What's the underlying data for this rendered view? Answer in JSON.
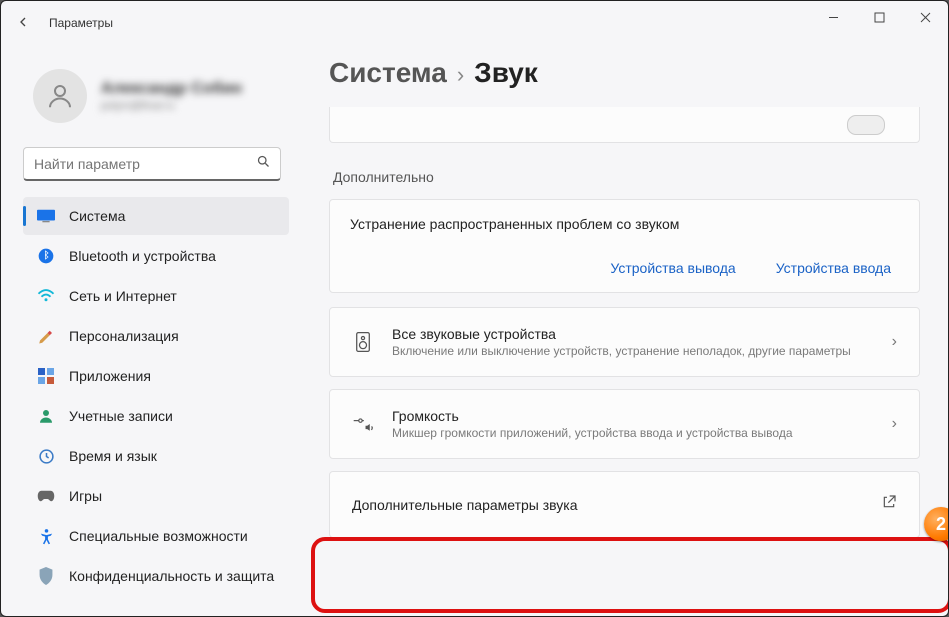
{
  "window": {
    "title": "Параметры"
  },
  "user": {
    "name": "Александр Собин",
    "email": "polym@final.ru"
  },
  "search": {
    "placeholder": "Найти параметр"
  },
  "sidebar": {
    "items": [
      {
        "label": "Система",
        "icon": "monitor",
        "active": true
      },
      {
        "label": "Bluetooth и устройства",
        "icon": "bluetooth"
      },
      {
        "label": "Сеть и Интернет",
        "icon": "wifi"
      },
      {
        "label": "Персонализация",
        "icon": "brush"
      },
      {
        "label": "Приложения",
        "icon": "apps"
      },
      {
        "label": "Учетные записи",
        "icon": "account"
      },
      {
        "label": "Время и язык",
        "icon": "time"
      },
      {
        "label": "Игры",
        "icon": "games"
      },
      {
        "label": "Специальные возможности",
        "icon": "accessibility"
      },
      {
        "label": "Конфиденциальность и защита",
        "icon": "privacy"
      }
    ]
  },
  "breadcrumb": {
    "parent": "Система",
    "current": "Звук"
  },
  "additional": {
    "heading": "Дополнительно",
    "troubleshoot": {
      "title": "Устранение распространенных проблем со звуком",
      "output_devices": "Устройства вывода",
      "input_devices": "Устройства ввода"
    },
    "all_devices": {
      "title": "Все звуковые устройства",
      "subtitle": "Включение или выключение устройств, устранение неполадок, другие параметры"
    },
    "volume_mixer": {
      "title": "Громкость",
      "subtitle": "Микшер громкости приложений, устройства ввода и устройства вывода"
    },
    "more_sound": {
      "title": "Дополнительные параметры звука"
    }
  },
  "callout": {
    "number": "2"
  }
}
